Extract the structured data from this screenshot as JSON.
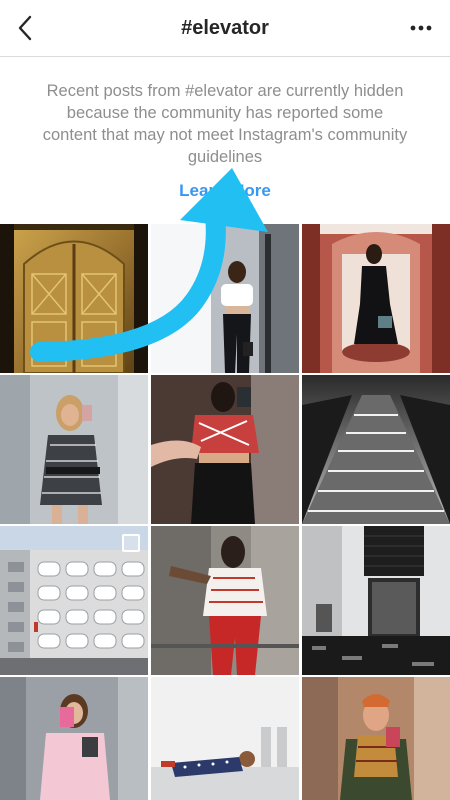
{
  "header": {
    "title": "#elevator",
    "back_icon": "chevron-left-icon",
    "more_icon": "more-horizontal-icon"
  },
  "notice": {
    "message": "Recent posts from #elevator are currently hidden because the community has reported some content that may not meet Instagram's community guidelines",
    "learn_more": "Learn More"
  },
  "grid": {
    "posts": [
      {
        "subject": "golden-elevator-doors",
        "multi": false
      },
      {
        "subject": "woman-in-elevator-white-top",
        "multi": false
      },
      {
        "subject": "woman-in-ornate-elevator",
        "multi": false
      },
      {
        "subject": "woman-selfie-gingham-dress",
        "multi": false
      },
      {
        "subject": "woman-selfie-red-top",
        "multi": false
      },
      {
        "subject": "escalator-black-white",
        "multi": false
      },
      {
        "subject": "modern-building-facade",
        "multi": true
      },
      {
        "subject": "woman-red-pants-elevator",
        "multi": false
      },
      {
        "subject": "elevator-lobby-marble",
        "multi": false
      },
      {
        "subject": "woman-selfie-pink-sweater",
        "multi": false
      },
      {
        "subject": "child-lying-on-floor",
        "multi": false
      },
      {
        "subject": "man-selfie-scarf",
        "multi": false
      }
    ]
  },
  "colors": {
    "text_primary": "#262626",
    "text_secondary": "#8e8e8e",
    "link": "#3897f0",
    "annotation_arrow": "#22bff2"
  }
}
